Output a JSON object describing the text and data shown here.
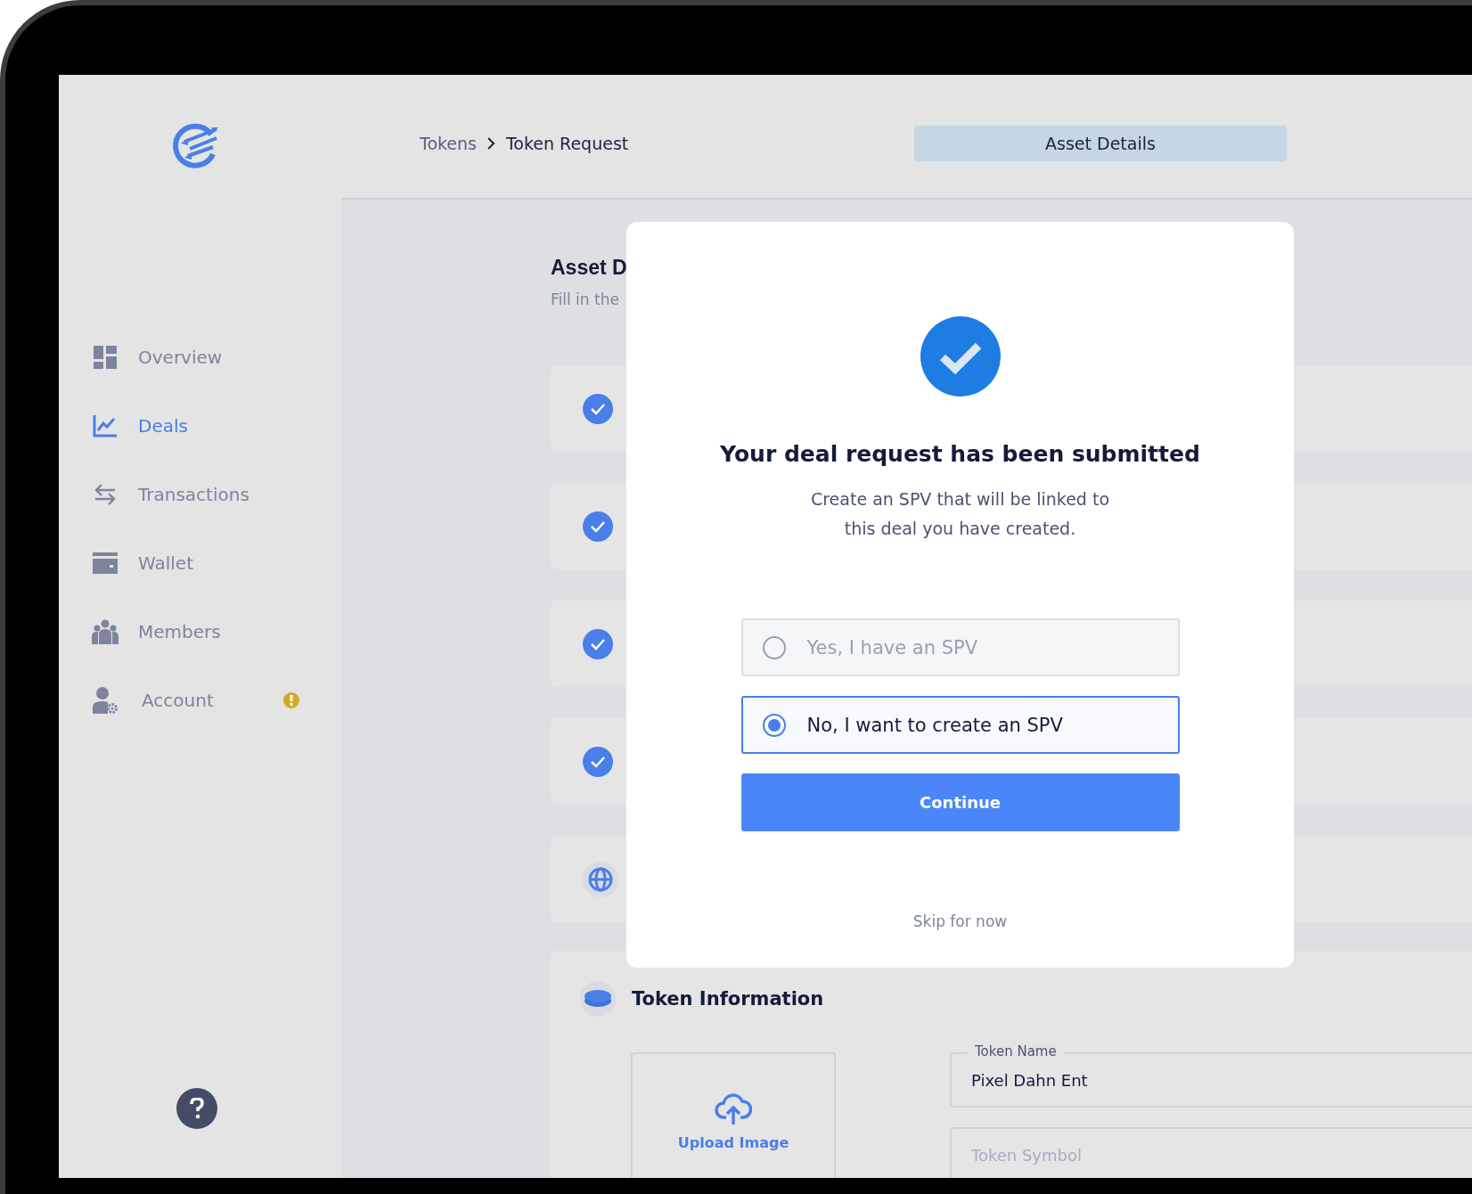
{
  "breadcrumb": [
    "Tokens",
    "Token Request"
  ],
  "header_tabs": [
    {
      "label": "Asset Details",
      "selected": true
    }
  ],
  "sidebar": {
    "items": [
      {
        "label": "Overview",
        "selected": false,
        "alert": false
      },
      {
        "label": "Deals",
        "selected": true,
        "alert": false
      },
      {
        "label": "Transactions",
        "selected": false,
        "alert": false
      },
      {
        "label": "Wallet",
        "selected": false,
        "alert": false
      },
      {
        "label": "Members",
        "selected": false,
        "alert": false
      },
      {
        "label": "Account",
        "selected": false,
        "alert": true
      }
    ]
  },
  "page": {
    "title": "Asset D",
    "subtitle": "Fill in the",
    "steps": [
      {
        "kind": "check"
      },
      {
        "kind": "check"
      },
      {
        "kind": "check"
      },
      {
        "kind": "check"
      },
      {
        "kind": "globe"
      }
    ],
    "token_information": {
      "title": "Token Information",
      "upload_label": "Upload Image",
      "fields": [
        {
          "label": "Token Name",
          "value": "Pixel Dahn Ent"
        },
        {
          "placeholder": "Token Symbol"
        }
      ]
    }
  },
  "modal": {
    "title": "Your deal request has been submitted",
    "message_lines": [
      "Create an SPV that will be linked to",
      "this deal you have created."
    ],
    "options": [
      {
        "label": "Yes, I have an SPV",
        "selected": false
      },
      {
        "label": "No, I want to create an SPV",
        "selected": true
      }
    ],
    "primary_button": "Continue",
    "link": "Skip for now"
  }
}
